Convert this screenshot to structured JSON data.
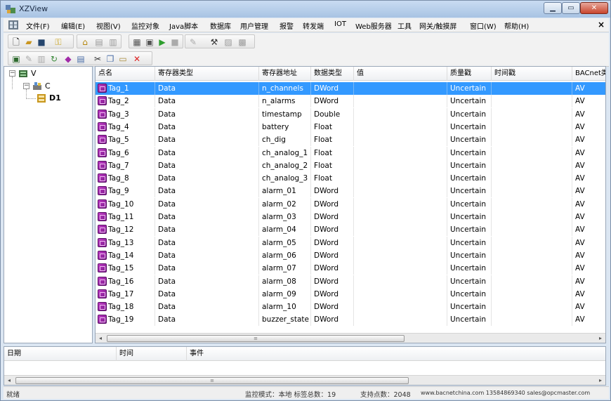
{
  "window": {
    "title": "XZView"
  },
  "menu": [
    "文件(F)",
    "编辑(E)",
    "视图(V)",
    "监控对象",
    "Java脚本",
    "数据库",
    "用户管理",
    "报警",
    "转发端",
    "IOT",
    "Web服务器",
    "工具",
    "网关/触摸屏",
    "窗口(W)",
    "帮助(H)"
  ],
  "tree": {
    "root": "V",
    "child": "C",
    "leaf": "D1"
  },
  "grid": {
    "columns": [
      "点名",
      "寄存器类型",
      "寄存器地址",
      "数据类型",
      "值",
      "质量戳",
      "时间戳",
      "BACnet类"
    ],
    "rows": [
      [
        "Tag_1",
        "Data",
        "n_channels",
        "DWord",
        "",
        "Uncertain",
        "",
        "AV"
      ],
      [
        "Tag_2",
        "Data",
        "n_alarms",
        "DWord",
        "",
        "Uncertain",
        "",
        "AV"
      ],
      [
        "Tag_3",
        "Data",
        "timestamp",
        "Double",
        "",
        "Uncertain",
        "",
        "AV"
      ],
      [
        "Tag_4",
        "Data",
        "battery",
        "Float",
        "",
        "Uncertain",
        "",
        "AV"
      ],
      [
        "Tag_5",
        "Data",
        "ch_dig",
        "Float",
        "",
        "Uncertain",
        "",
        "AV"
      ],
      [
        "Tag_6",
        "Data",
        "ch_analog_1",
        "Float",
        "",
        "Uncertain",
        "",
        "AV"
      ],
      [
        "Tag_7",
        "Data",
        "ch_analog_2",
        "Float",
        "",
        "Uncertain",
        "",
        "AV"
      ],
      [
        "Tag_8",
        "Data",
        "ch_analog_3",
        "Float",
        "",
        "Uncertain",
        "",
        "AV"
      ],
      [
        "Tag_9",
        "Data",
        "alarm_01",
        "DWord",
        "",
        "Uncertain",
        "",
        "AV"
      ],
      [
        "Tag_10",
        "Data",
        "alarm_02",
        "DWord",
        "",
        "Uncertain",
        "",
        "AV"
      ],
      [
        "Tag_11",
        "Data",
        "alarm_03",
        "DWord",
        "",
        "Uncertain",
        "",
        "AV"
      ],
      [
        "Tag_12",
        "Data",
        "alarm_04",
        "DWord",
        "",
        "Uncertain",
        "",
        "AV"
      ],
      [
        "Tag_13",
        "Data",
        "alarm_05",
        "DWord",
        "",
        "Uncertain",
        "",
        "AV"
      ],
      [
        "Tag_14",
        "Data",
        "alarm_06",
        "DWord",
        "",
        "Uncertain",
        "",
        "AV"
      ],
      [
        "Tag_15",
        "Data",
        "alarm_07",
        "DWord",
        "",
        "Uncertain",
        "",
        "AV"
      ],
      [
        "Tag_16",
        "Data",
        "alarm_08",
        "DWord",
        "",
        "Uncertain",
        "",
        "AV"
      ],
      [
        "Tag_17",
        "Data",
        "alarm_09",
        "DWord",
        "",
        "Uncertain",
        "",
        "AV"
      ],
      [
        "Tag_18",
        "Data",
        "alarm_10",
        "DWord",
        "",
        "Uncertain",
        "",
        "AV"
      ],
      [
        "Tag_19",
        "Data",
        "buzzer_state",
        "DWord",
        "",
        "Uncertain",
        "",
        "AV"
      ]
    ]
  },
  "events": {
    "columns": [
      "日期",
      "时间",
      "事件"
    ]
  },
  "status": {
    "left": "就绪",
    "mode": "监控模式：本地 标签总数：19",
    "support": "支持点数：2048",
    "contact": "www.bacnetchina.com 13584869340 sales@opcmaster.com"
  },
  "colors": {
    "selection": "#3399ff",
    "tag_icon": "#a12aa8"
  }
}
